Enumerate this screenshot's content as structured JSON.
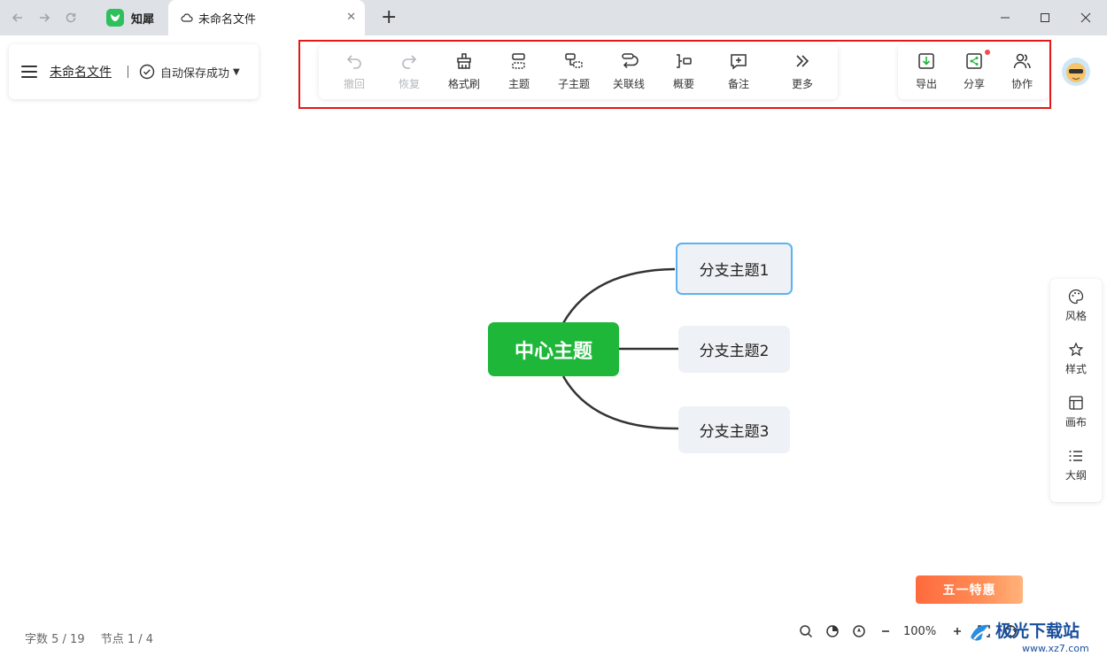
{
  "browser": {
    "app_tab_label": "知犀",
    "active_tab_label": "未命名文件",
    "new_tab_symbol": "+"
  },
  "file_panel": {
    "filename": "未命名文件",
    "save_status": "自动保存成功"
  },
  "toolbar": {
    "items": [
      {
        "label": "撤回",
        "icon": "undo-icon",
        "disabled": true
      },
      {
        "label": "恢复",
        "icon": "redo-icon",
        "disabled": true
      },
      {
        "label": "格式刷",
        "icon": "format-brush-icon",
        "disabled": false
      },
      {
        "label": "主题",
        "icon": "topic-icon",
        "disabled": false
      },
      {
        "label": "子主题",
        "icon": "subtopic-icon",
        "disabled": false
      },
      {
        "label": "关联线",
        "icon": "relation-line-icon",
        "disabled": false
      },
      {
        "label": "概要",
        "icon": "summary-icon",
        "disabled": false
      },
      {
        "label": "备注",
        "icon": "note-icon",
        "disabled": false
      },
      {
        "label": "更多",
        "icon": "more-icon",
        "disabled": false
      }
    ],
    "right_items": [
      {
        "label": "导出",
        "icon": "export-icon"
      },
      {
        "label": "分享",
        "icon": "share-icon"
      },
      {
        "label": "协作",
        "icon": "collaborate-icon"
      }
    ]
  },
  "mindmap": {
    "center": "中心主题",
    "branches": [
      "分支主题1",
      "分支主题2",
      "分支主题3"
    ]
  },
  "side_panel": {
    "items": [
      {
        "label": "风格",
        "icon": "palette-icon"
      },
      {
        "label": "样式",
        "icon": "style-icon"
      },
      {
        "label": "画布",
        "icon": "canvas-icon"
      },
      {
        "label": "大纲",
        "icon": "outline-icon"
      }
    ]
  },
  "status_bar": {
    "word_count": "字数 5 / 19",
    "node_count": "节点 1 / 4",
    "zoom": "100%"
  },
  "promo": {
    "text": "五一特惠"
  },
  "watermark": {
    "text": "极光下载站",
    "url": "www.xz7.com"
  },
  "colors": {
    "center_node": "#1fb73a",
    "branch_node": "#eef1f5",
    "selection_border": "#5ab3f0",
    "highlight_box": "#e31818"
  }
}
